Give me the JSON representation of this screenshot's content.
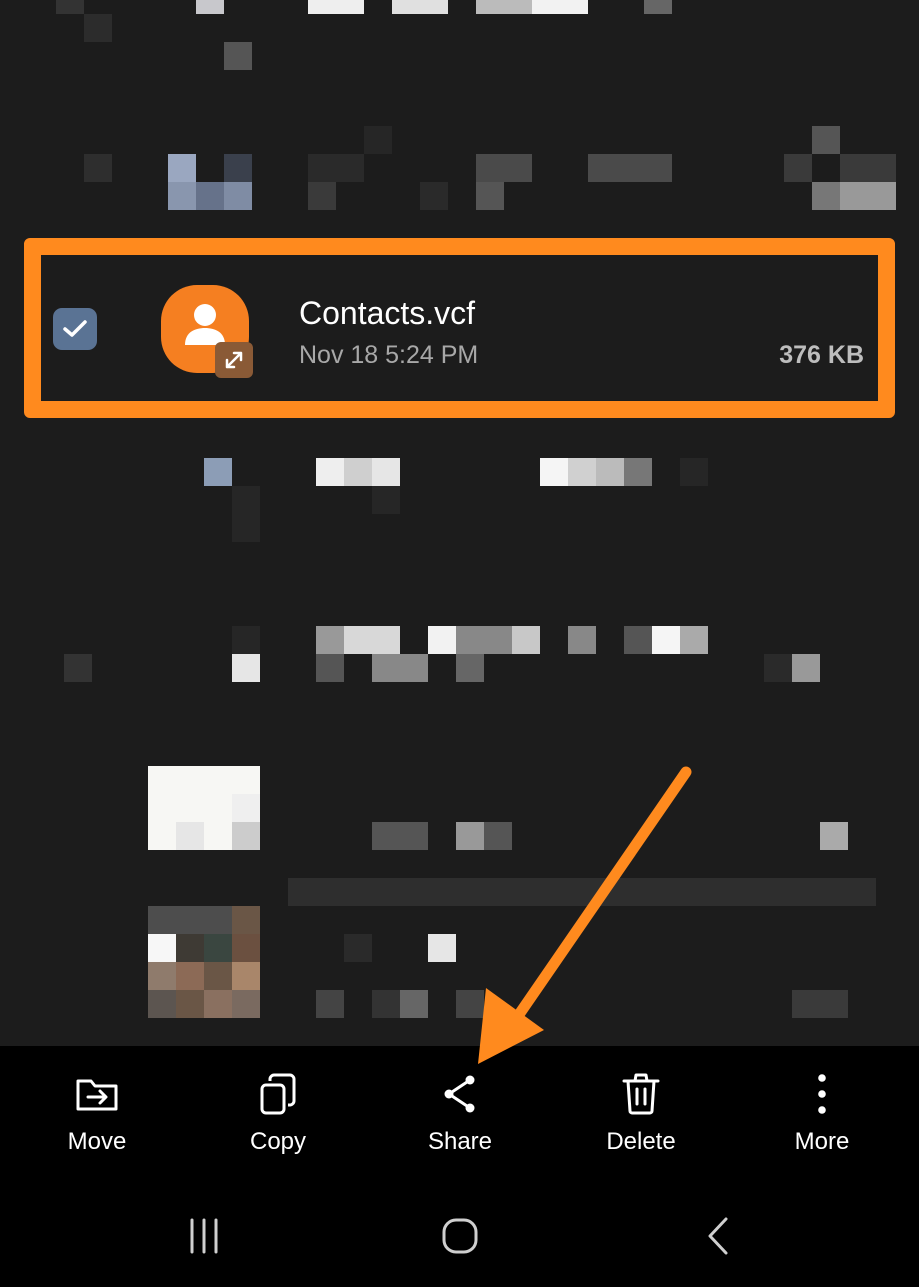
{
  "file": {
    "name": "Contacts.vcf",
    "date": "Nov 18 5:24 PM",
    "size": "376 KB",
    "selected": true
  },
  "toolbar": {
    "move_label": "Move",
    "copy_label": "Copy",
    "share_label": "Share",
    "delete_label": "Delete",
    "more_label": "More"
  },
  "icons": {
    "checkbox": "check-icon",
    "file": "contact-file-icon",
    "move": "move-to-folder-icon",
    "copy": "copy-icon",
    "share": "share-icon",
    "delete": "trash-icon",
    "more": "more-vertical-icon",
    "nav_recents": "recents-icon",
    "nav_home": "home-icon",
    "nav_back": "back-icon"
  },
  "colors": {
    "highlight": "#ff8a1e",
    "file_icon": "#f57f21",
    "checkbox": "#5a7394",
    "background": "#1c1c1c",
    "toolbar": "#000000"
  }
}
